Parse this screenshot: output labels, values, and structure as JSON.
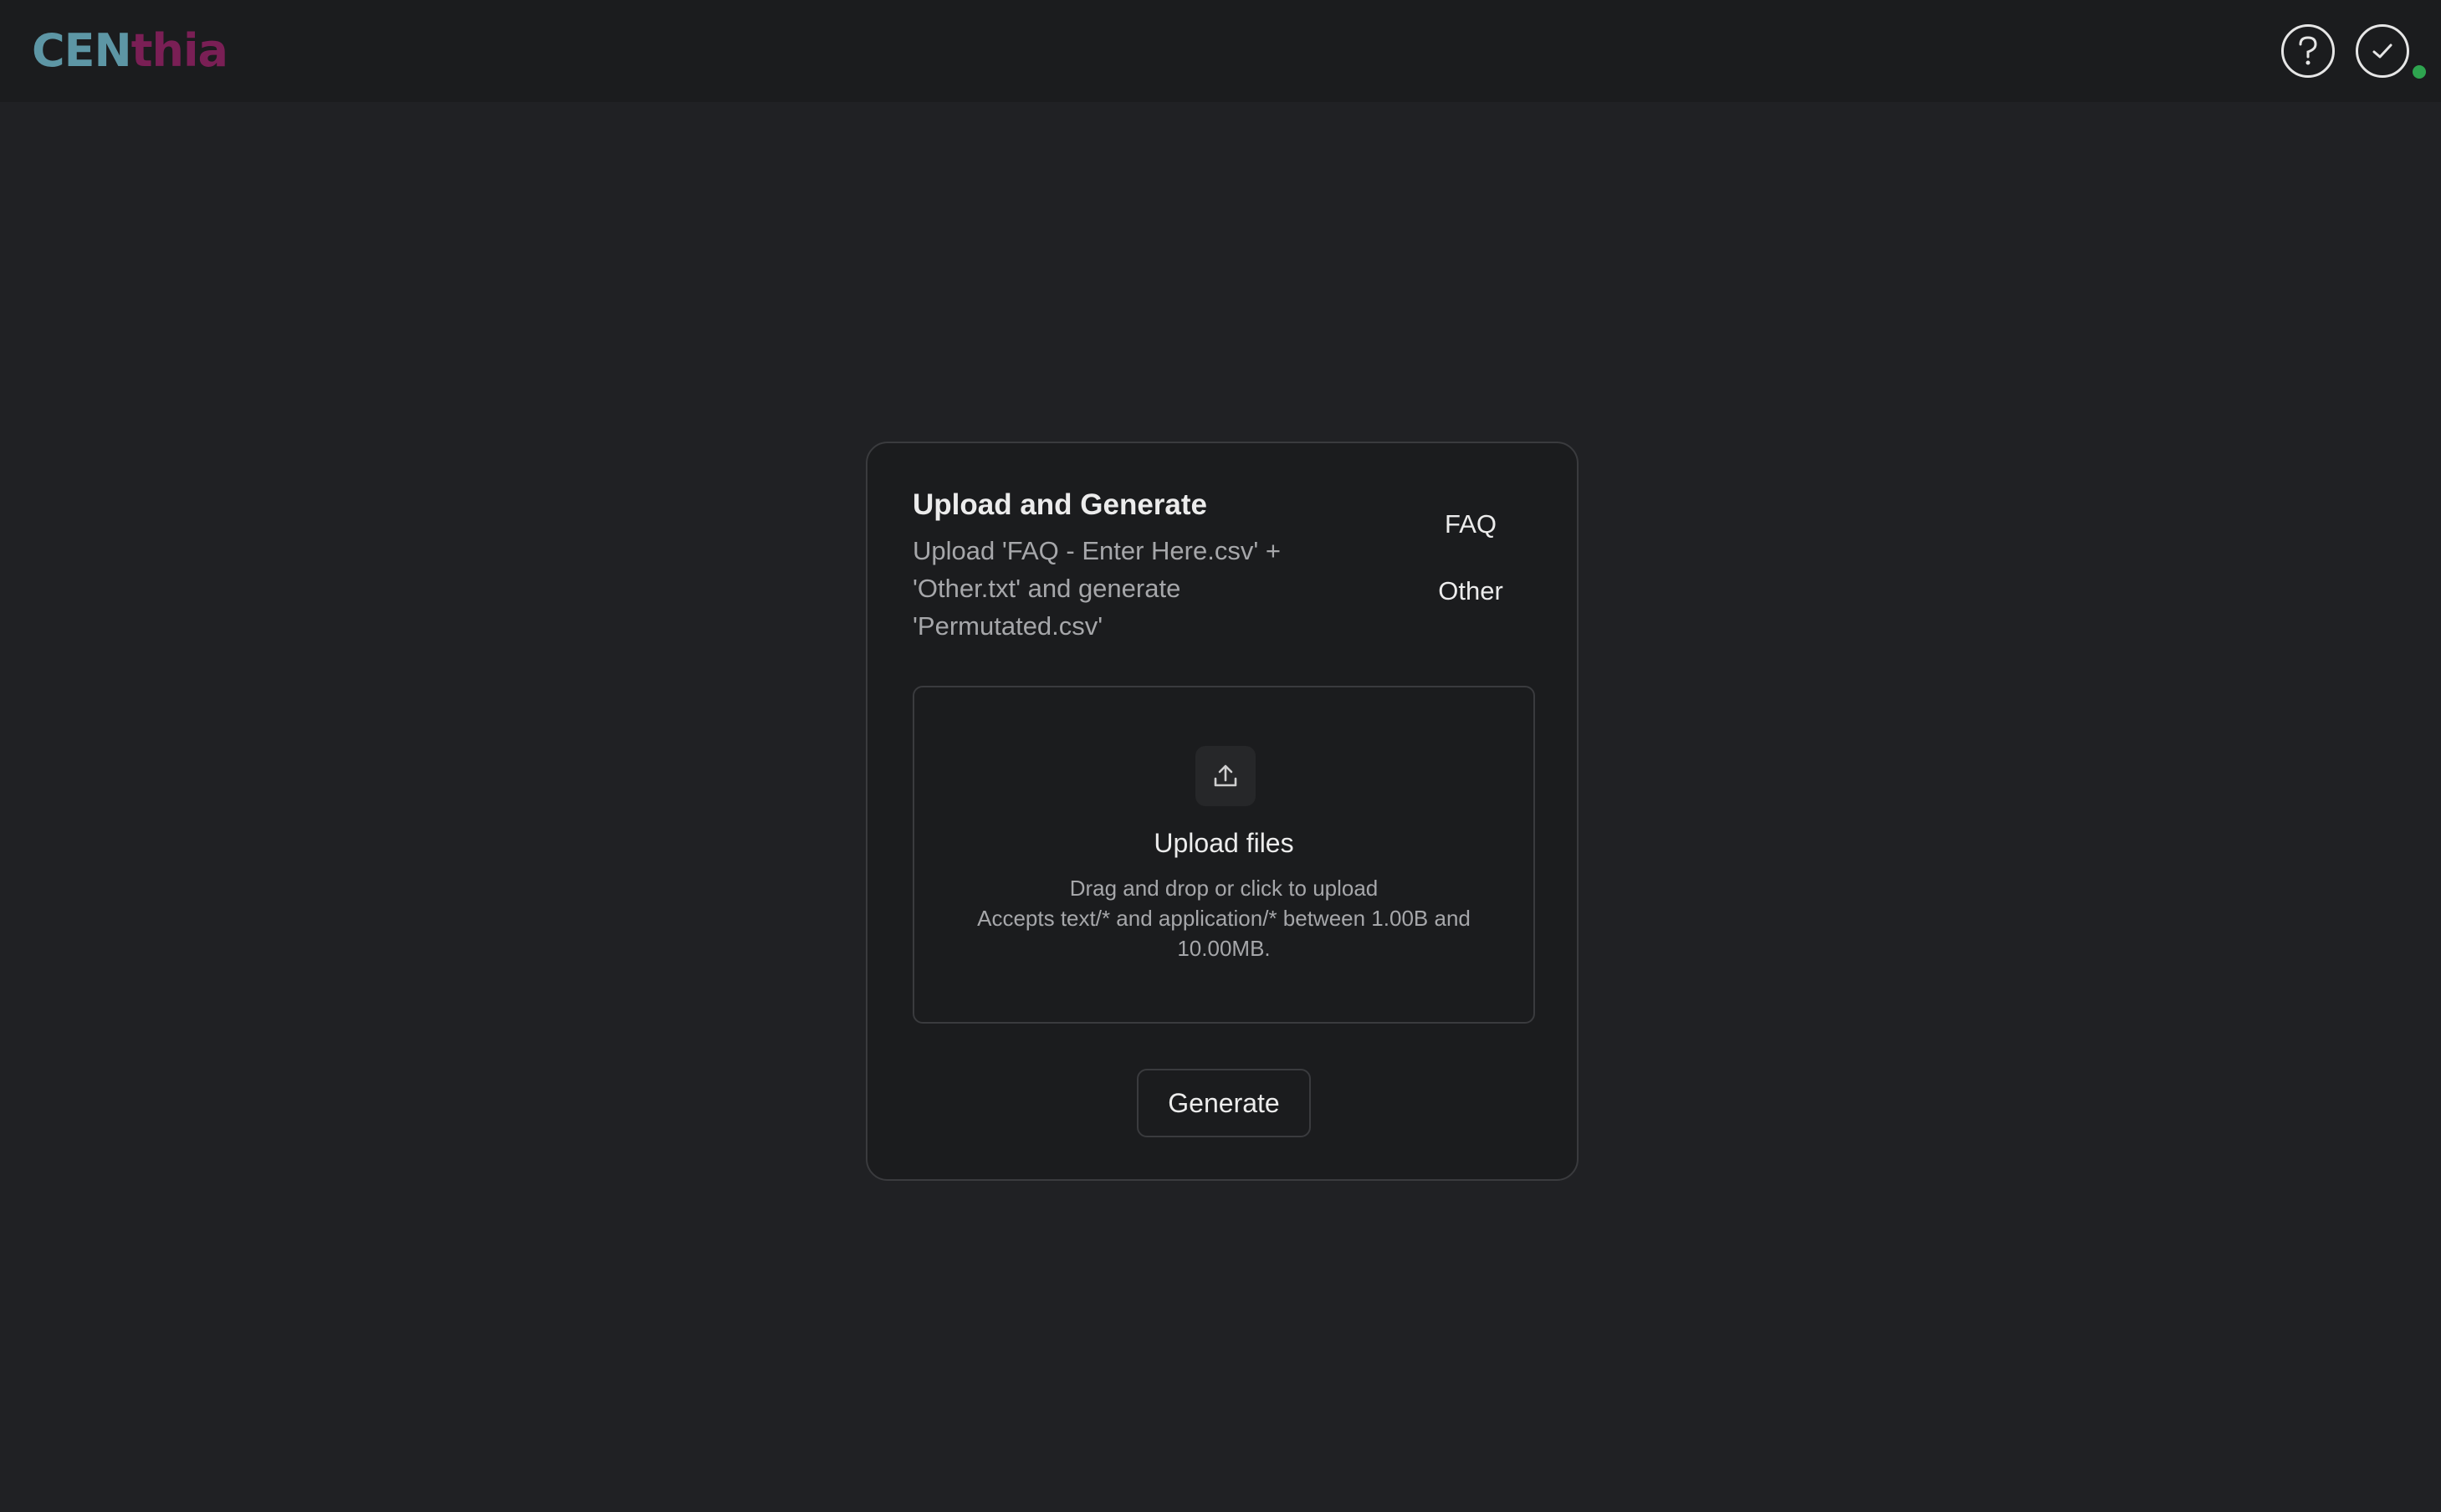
{
  "app": {
    "logo_part1": "CEN",
    "logo_part2": "thia",
    "colors": {
      "logo_cen": "#5d96a5",
      "logo_thia": "#7a1f55",
      "status_online": "#2ea44f"
    }
  },
  "header": {
    "help_icon": "help-circle-icon",
    "status_icon": "check-circle-icon"
  },
  "card": {
    "title": "Upload and Generate",
    "description": "Upload 'FAQ - Enter Here.csv' + 'Other.txt' and generate 'Permutated.csv'",
    "links": [
      "FAQ",
      "Other"
    ],
    "dropzone": {
      "icon": "upload-icon",
      "title": "Upload files",
      "hint_line1": "Drag and drop or click to upload",
      "hint_line2": "Accepts text/* and application/* between 1.00B and 10.00MB."
    },
    "generate_label": "Generate"
  }
}
